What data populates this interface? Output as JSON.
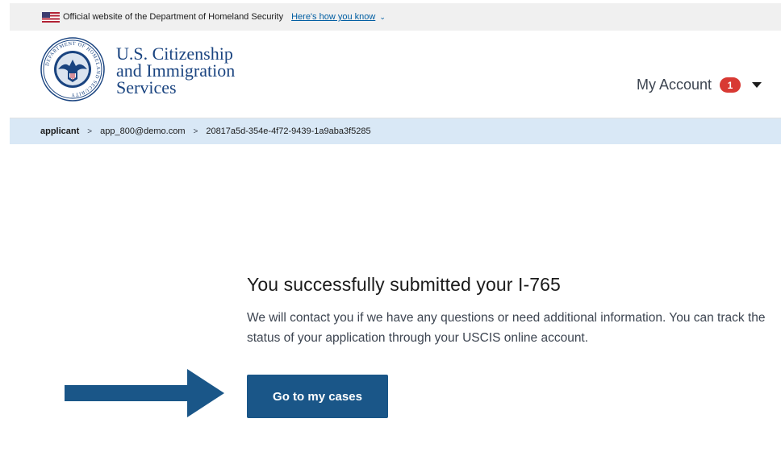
{
  "banner": {
    "official_text": "Official website of the Department of Homeland Security",
    "how_link": "Here's how you know",
    "chevron": "⌄"
  },
  "header": {
    "agency_line1": "U.S. Citizenship",
    "agency_line2": "and Immigration",
    "agency_line3": "Services",
    "seal_text": "DEPARTMENT OF HOMELAND SECURITY",
    "account_label": "My Account",
    "notification_count": "1"
  },
  "breadcrumb": {
    "items": [
      "applicant",
      "app_800@demo.com",
      "20817a5d-354e-4f72-9439-1a9aba3f5285"
    ],
    "separator": ">"
  },
  "main": {
    "title": "You successfully submitted your I-765",
    "body": "We will contact you if we have any questions or need additional information. You can track the status of your application through your USCIS online account.",
    "button_label": "Go to my cases"
  },
  "colors": {
    "brand_navy": "#1a4480",
    "button_blue": "#1a5688",
    "arrow_blue": "#1a5688",
    "breadcrumb_bg": "#d9e8f6",
    "badge_red": "#d83933"
  }
}
